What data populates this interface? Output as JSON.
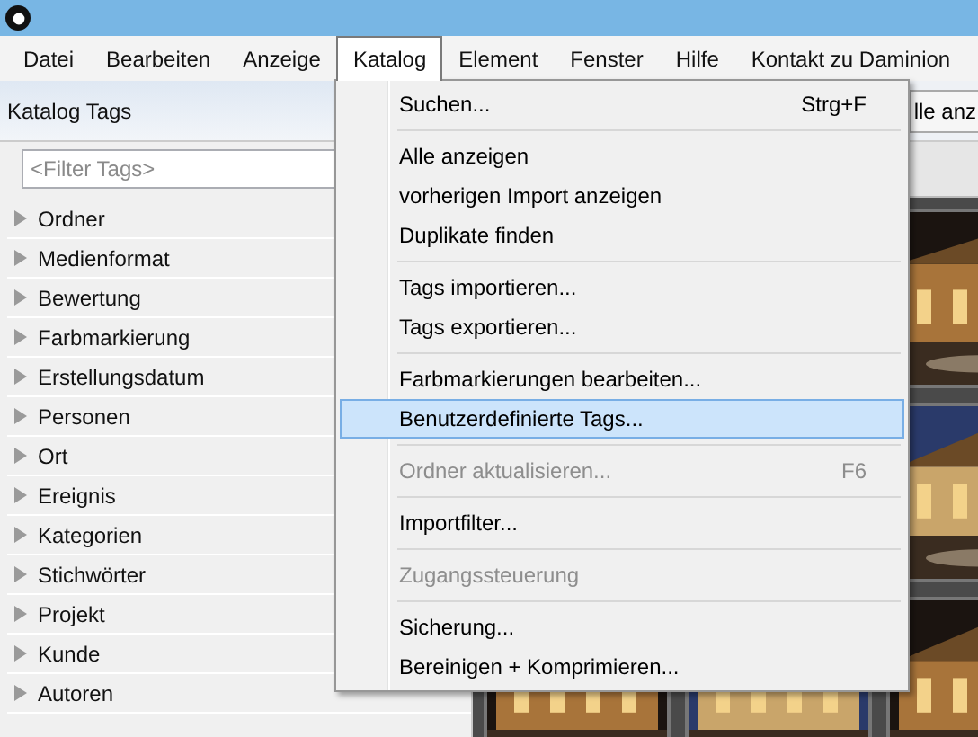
{
  "menu_bar": [
    {
      "label": "Datei",
      "selected": false
    },
    {
      "label": "Bearbeiten",
      "selected": false
    },
    {
      "label": "Anzeige",
      "selected": false
    },
    {
      "label": "Katalog",
      "selected": true
    },
    {
      "label": "Element",
      "selected": false
    },
    {
      "label": "Fenster",
      "selected": false
    },
    {
      "label": "Hilfe",
      "selected": false
    },
    {
      "label": "Kontakt zu Daminion",
      "selected": false
    }
  ],
  "sidebar": {
    "title": "Katalog Tags",
    "filter": {
      "placeholder": "<Filter Tags>"
    },
    "items": [
      {
        "label": "Ordner",
        "expanded": false
      },
      {
        "label": "Medienformat",
        "expanded": false
      },
      {
        "label": "Bewertung",
        "expanded": false
      },
      {
        "label": "Farbmarkierung",
        "expanded": false
      },
      {
        "label": "Erstellungsdatum",
        "expanded": false
      },
      {
        "label": "Personen",
        "expanded": false
      },
      {
        "label": "Ort",
        "expanded": false
      },
      {
        "label": "Ereignis",
        "expanded": false
      },
      {
        "label": "Kategorien",
        "expanded": false
      },
      {
        "label": "Stichwörter",
        "expanded": false
      },
      {
        "label": "Projekt",
        "expanded": false
      },
      {
        "label": "Kunde",
        "expanded": false
      },
      {
        "label": "Autoren",
        "expanded": false
      }
    ]
  },
  "content": {
    "toolbar_button": "lle anz"
  },
  "dropdown_menu": {
    "groups": [
      [
        {
          "label": "Suchen...",
          "shortcut": "Strg+F",
          "disabled": false,
          "selected": false
        }
      ],
      [
        {
          "label": "Alle anzeigen",
          "disabled": false,
          "selected": false
        },
        {
          "label": "vorherigen Import anzeigen",
          "disabled": false,
          "selected": false
        },
        {
          "label": "Duplikate finden",
          "disabled": false,
          "selected": false
        }
      ],
      [
        {
          "label": "Tags importieren...",
          "disabled": false,
          "selected": false
        },
        {
          "label": "Tags exportieren...",
          "disabled": false,
          "selected": false
        }
      ],
      [
        {
          "label": "Farbmarkierungen bearbeiten...",
          "disabled": false,
          "selected": false
        },
        {
          "label": "Benutzerdefinierte Tags...",
          "disabled": false,
          "selected": true
        }
      ],
      [
        {
          "label": "Ordner aktualisieren...",
          "shortcut": "F6",
          "disabled": true,
          "selected": false
        }
      ],
      [
        {
          "label": "Importfilter...",
          "disabled": false,
          "selected": false
        }
      ],
      [
        {
          "label": "Zugangssteuerung",
          "disabled": true,
          "selected": false
        }
      ],
      [
        {
          "label": "Sicherung...",
          "disabled": false,
          "selected": false
        },
        {
          "label": "Bereinigen + Komprimieren...",
          "disabled": false,
          "selected": false
        }
      ]
    ]
  }
}
